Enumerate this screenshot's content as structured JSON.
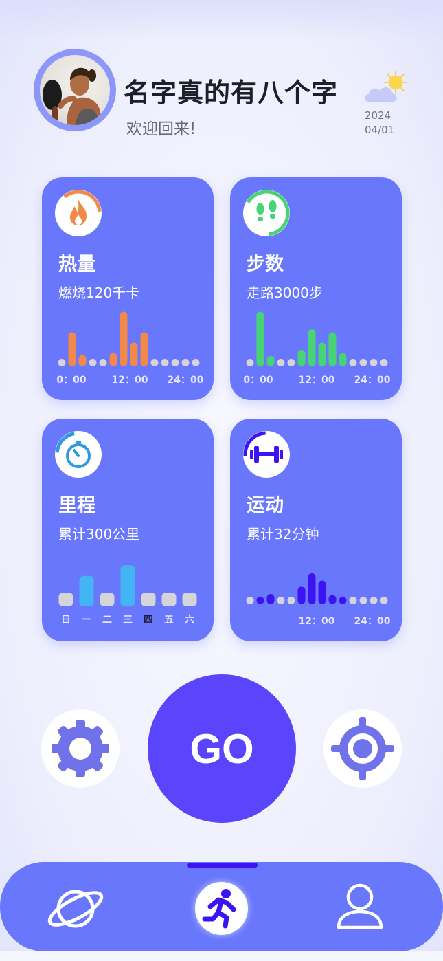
{
  "header": {
    "user_name": "名字真的有八个字",
    "welcome": "欢迎回来!",
    "date_year": "2024",
    "date_day": "04/01",
    "weather_icon": "partly-cloudy-icon"
  },
  "colors": {
    "card_bg": "#6877fb",
    "go_button": "#5a45fd",
    "calories": "#f0894a",
    "steps": "#47d474",
    "distance": "#43b5f4",
    "exercise": "#3c14f1",
    "inactive": "#d4d4d9"
  },
  "cards": {
    "calories": {
      "icon": "flame-icon",
      "title": "热量",
      "subtitle": "燃烧120千卡",
      "ring_progress": 0.35,
      "axis": [
        "0：00",
        "12：00",
        "24：00"
      ],
      "values": [
        0,
        3.3,
        1.1,
        0,
        0,
        1.3,
        5.3,
        2.3,
        3.3,
        0,
        0,
        0,
        0,
        0
      ]
    },
    "steps": {
      "icon": "footprints-icon",
      "title": "步数",
      "subtitle": "走路3000步",
      "ring_progress": 0.65,
      "axis": [
        "0：00",
        "12：00",
        "24：00"
      ],
      "values": [
        0,
        5.3,
        1.0,
        0,
        0,
        1.6,
        3.6,
        2.3,
        3.3,
        1.3,
        0,
        0,
        0,
        0
      ]
    },
    "distance": {
      "icon": "stopwatch-icon",
      "title": "里程",
      "subtitle": "累计300公里",
      "ring_progress": 0.2,
      "days": [
        "日",
        "一",
        "二",
        "三",
        "四",
        "五",
        "六"
      ],
      "current_day": "四",
      "values": [
        0,
        1.7,
        0,
        2.3,
        0,
        0,
        0
      ]
    },
    "exercise": {
      "icon": "dumbbell-icon",
      "title": "运动",
      "subtitle": "累计32分钟",
      "ring_progress": 0.25,
      "axis": [
        "12：00",
        "24：00"
      ],
      "values": [
        0,
        0.3,
        1,
        0,
        0,
        1.7,
        3,
        2.3,
        0.9,
        0.3,
        0,
        0,
        0,
        0
      ]
    }
  },
  "actions": {
    "go_label": "GO",
    "settings_icon": "gear-icon",
    "location_icon": "target-icon"
  },
  "tabbar": {
    "tabs": [
      {
        "icon": "planet-icon",
        "active": false
      },
      {
        "icon": "running-icon",
        "active": true
      },
      {
        "icon": "user-icon",
        "active": false
      }
    ]
  }
}
